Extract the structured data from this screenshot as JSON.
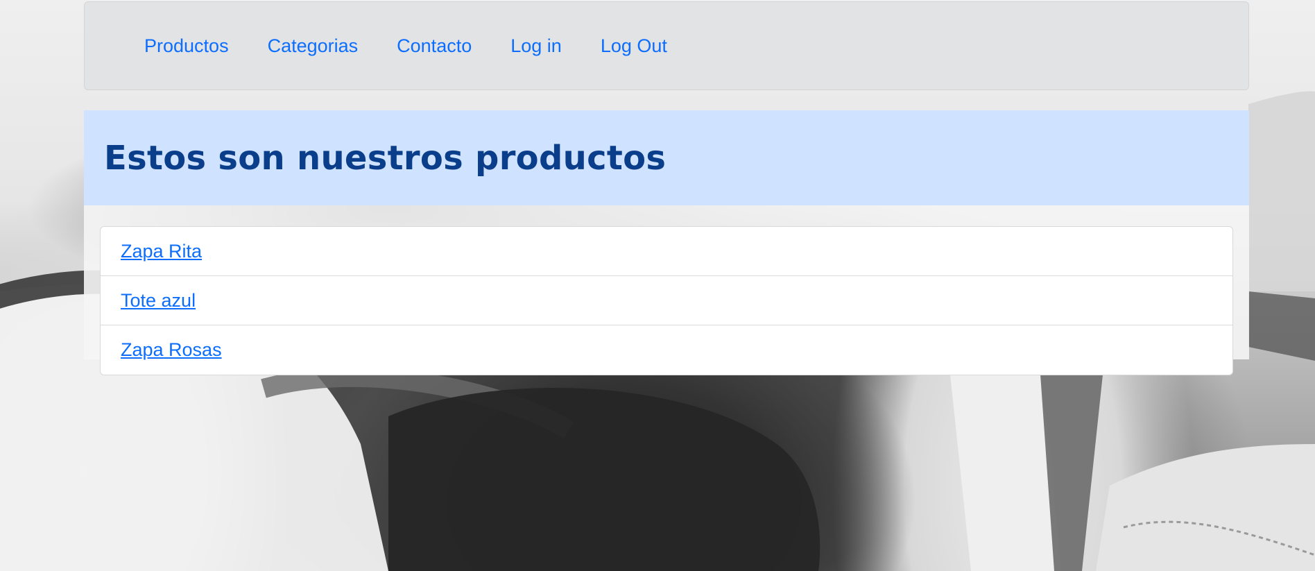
{
  "nav": {
    "items": [
      {
        "label": "Productos"
      },
      {
        "label": "Categorias"
      },
      {
        "label": "Contacto"
      },
      {
        "label": "Log in"
      },
      {
        "label": "Log Out"
      }
    ]
  },
  "header": {
    "title": "Estos son nuestros productos"
  },
  "products": {
    "items": [
      {
        "label": "Zapa Rita"
      },
      {
        "label": "Tote azul"
      },
      {
        "label": "Zapa Rosas"
      }
    ]
  },
  "colors": {
    "link": "#0d6efd",
    "navbar_bg": "#e2e3e5",
    "header_bg": "#cfe2ff",
    "header_text": "#0a3e8a"
  }
}
